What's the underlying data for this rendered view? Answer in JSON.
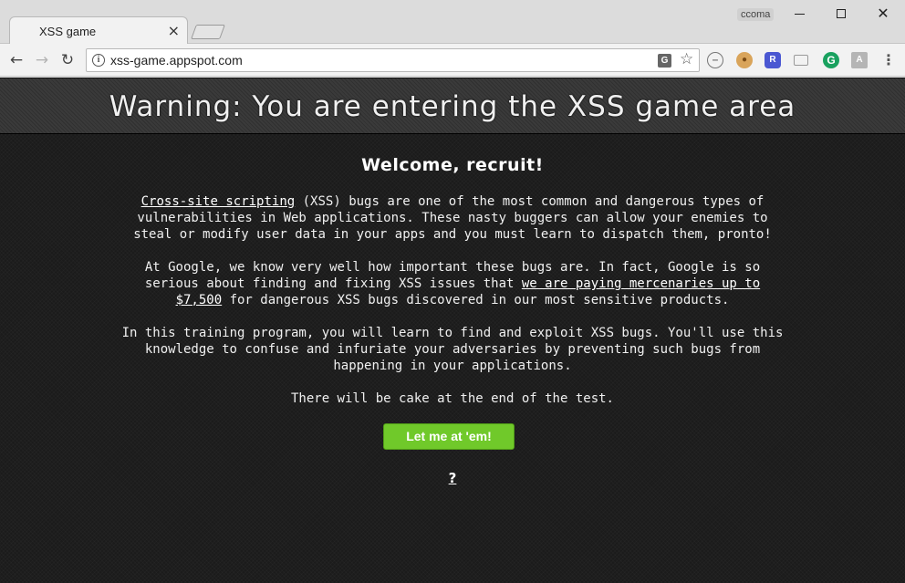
{
  "browser": {
    "profile_name": "ccoma",
    "tab": {
      "title": "XSS game",
      "close_glyph": "×"
    },
    "window_controls": {
      "close_glyph": "✕"
    },
    "nav": {
      "back_glyph": "←",
      "forward_glyph": "→",
      "reload_glyph": "↻"
    },
    "omnibox": {
      "url": "xss-game.appspot.com",
      "info_glyph": "i",
      "star_glyph": "☆",
      "translate_glyph": "G"
    },
    "extensions": [
      {
        "icon": "block-icon",
        "glyph": "–"
      },
      {
        "icon": "cookie-icon",
        "glyph": "●"
      },
      {
        "icon": "r-extension-icon",
        "glyph": "R"
      },
      {
        "icon": "cast-icon",
        "glyph": ""
      },
      {
        "icon": "grammarly-icon",
        "glyph": "G"
      },
      {
        "icon": "pdf-icon",
        "glyph": "A"
      }
    ],
    "menu_glyph": "⋮"
  },
  "page": {
    "banner_title": "Warning: You are entering the XSS game area",
    "welcome": "Welcome, recruit!",
    "p1": {
      "link": "Cross-site scripting",
      "text": " (XSS) bugs are one of the most common and dangerous types of vulnerabilities in Web applications. These nasty buggers can allow your enemies to steal or modify user data in your apps and you must learn to dispatch them, pronto!"
    },
    "p2": {
      "before": "At Google, we know very well how important these bugs are. In fact, Google is so serious about finding and fixing XSS issues that ",
      "link": "we are paying mercenaries up to $7,500",
      "after": " for dangerous XSS bugs discovered in our most sensitive products."
    },
    "p3": "In this training program, you will learn to find and exploit XSS bugs. You'll use this knowledge to confuse and infuriate your adversaries by preventing such bugs from happening in your applications.",
    "p4": "There will be cake at the end of the test.",
    "cta_label": "Let me at 'em!",
    "help_label": "?"
  },
  "colors": {
    "page_bg": "#1b1b1b",
    "banner_bg": "#3a3a3a",
    "cta_bg": "#70c92a",
    "text": "#f0f0f0"
  }
}
